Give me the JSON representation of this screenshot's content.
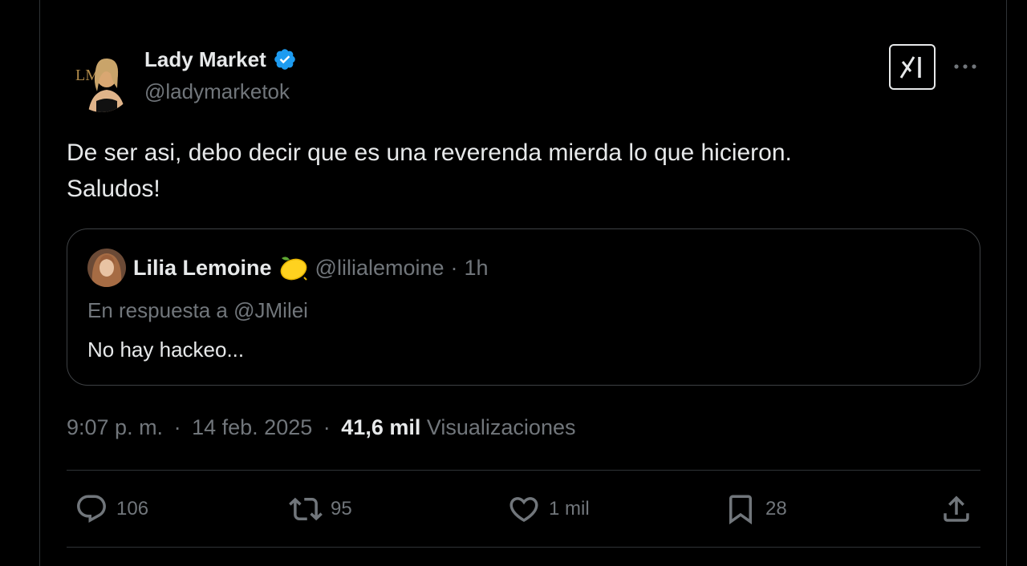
{
  "tweet": {
    "author": {
      "name": "Lady Market",
      "handle": "@ladymarketok",
      "avatar_monogram": "LM",
      "verified": true,
      "verified_color": "#1d9bf0"
    },
    "text": "De ser asi, debo decir que es una reverenda mierda lo que hicieron.\nSaludos!",
    "quote": {
      "author_name": "Lilia Lemoine",
      "author_emoji_icon": "lemon-icon",
      "author_handle": "@lilialemoine",
      "separator": "·",
      "time_ago": "1h",
      "reply_to": "En respuesta a @JMilei",
      "text": "No hay hackeo..."
    },
    "meta": {
      "time": "9:07 p. m.",
      "separator": "·",
      "date": "14 feb. 2025",
      "views_count": "41,6 mil",
      "views_label": "Visualizaciones"
    },
    "actions": {
      "replies": "106",
      "reposts": "95",
      "likes": "1 mil",
      "bookmarks": "28"
    },
    "icons": {
      "grok": "grok-icon",
      "more": "more-icon",
      "reply": "reply-icon",
      "repost": "repost-icon",
      "like": "heart-icon",
      "bookmark": "bookmark-icon",
      "share": "share-icon"
    }
  },
  "colors": {
    "background": "#000000",
    "text_primary": "#e7e9ea",
    "text_secondary": "#71767b",
    "border": "#2f3336",
    "accent": "#1d9bf0"
  }
}
